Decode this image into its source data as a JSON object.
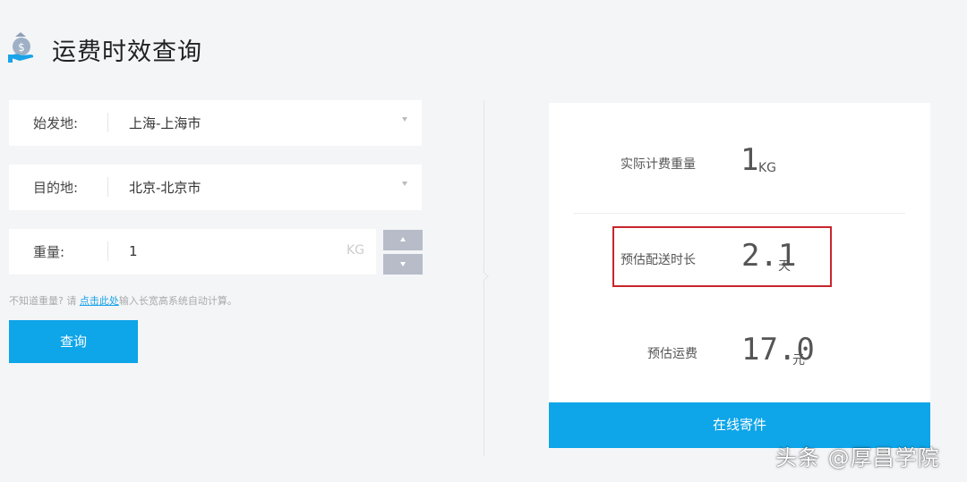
{
  "header": {
    "title": "运费时效查询",
    "icon": "money-bag-hand-icon"
  },
  "form": {
    "origin": {
      "label": "始发地:",
      "value": "上海-上海市"
    },
    "destination": {
      "label": "目的地:",
      "value": "北京-北京市"
    },
    "weight": {
      "label": "重量:",
      "value": "1",
      "unit": "KG"
    },
    "hint": {
      "before": "不知道重量? 请 ",
      "link": "点击此处",
      "after": "输入长宽高系统自动计算。"
    },
    "query_label": "查询"
  },
  "results": {
    "billed_weight": {
      "label": "实际计费重量",
      "value": "1",
      "unit": "KG"
    },
    "delivery_time": {
      "label": "预估配送时长",
      "value": "2.1",
      "unit": "天"
    },
    "shipping_fee": {
      "label": "预估运费",
      "value": "17.0",
      "unit": "元"
    },
    "ship_label": "在线寄件"
  },
  "watermark": "头条 @厚昌学院",
  "colors": {
    "accent": "#0ea5e9",
    "highlight": "#c8252c",
    "background": "#f4f5f7"
  }
}
